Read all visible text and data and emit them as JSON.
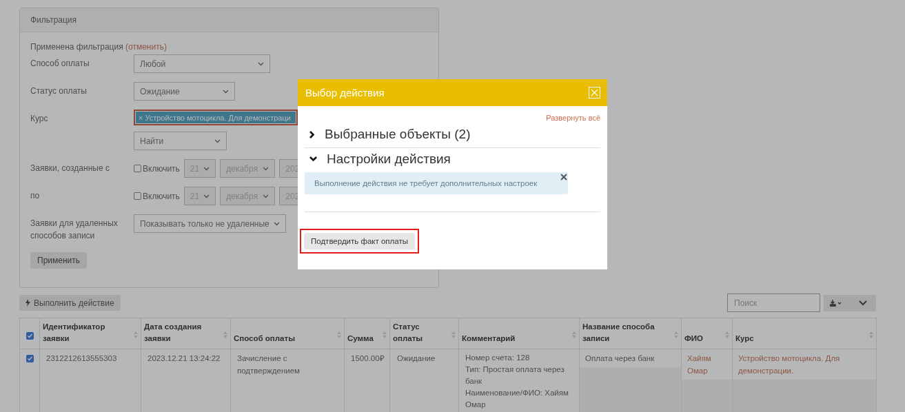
{
  "filter": {
    "title": "Фильтрация",
    "applied_text": "Применена фильтрация",
    "cancel_link": "(отменить)",
    "fields": [
      {
        "kind": "select",
        "label": "Способ оплаты",
        "value": "Любой"
      },
      {
        "kind": "select",
        "label": "Статус оплаты",
        "value": "Ожидание"
      },
      {
        "kind": "tags",
        "label": "Курс",
        "tags": [
          {
            "remove_symbol": "×",
            "label": "Устройство мотоцикла. Для демонстраци"
          }
        ],
        "search_value": "Найти"
      },
      {
        "kind": "date",
        "label": "Заявки, созданные с",
        "include_label": "Включить",
        "checked": false,
        "day": "21",
        "month": "декабря",
        "year": "202"
      },
      {
        "kind": "date",
        "label": "по",
        "include_label": "Включить",
        "checked": false,
        "day": "21",
        "month": "декабря",
        "year": "202"
      },
      {
        "kind": "select",
        "label": "Заявки для удаленных способов записи",
        "value": "Показывать только не удаленные"
      }
    ],
    "apply_button": "Применить"
  },
  "toolbar": {
    "action_button": "Выполнить действие",
    "search": {
      "placeholder": "Поиск"
    }
  },
  "table": {
    "select_all_checked": true,
    "columns": [
      "Идентификатор заявки",
      "Дата создания заявки",
      "Способ оплаты",
      "Сумма",
      "Статус оплаты",
      "Комментарий",
      "Название способа записи",
      "ФИО",
      "Курс"
    ],
    "rows": [
      {
        "selected": true,
        "id": "2312212613555303",
        "date": "2023.12.21 13:24:22",
        "method": "Зачисление с подтверждением",
        "sum": "1500.00₽",
        "status": "Ожидание",
        "comment": [
          "Номер счета: 128",
          "Тип: Простая оплата через банк",
          "Наименование/ФИО: Хайям Омар"
        ],
        "record_method": "Оплата через банк",
        "fio": "Хайям Омар",
        "course": "Устройство мотоцикла. Для демонстрации."
      }
    ]
  },
  "modal": {
    "title": "Выбор действия",
    "expand_all": "Развернуть всё",
    "sections": [
      {
        "title": "Выбранные объекты (2)",
        "expanded": false
      },
      {
        "title": "Настройки действия",
        "expanded": true
      }
    ],
    "info_text": "Выполнение действия не требует дополнительных настроек",
    "confirm_button": "Подтвердить факт оплаты",
    "confirm_highlighted": true
  }
}
